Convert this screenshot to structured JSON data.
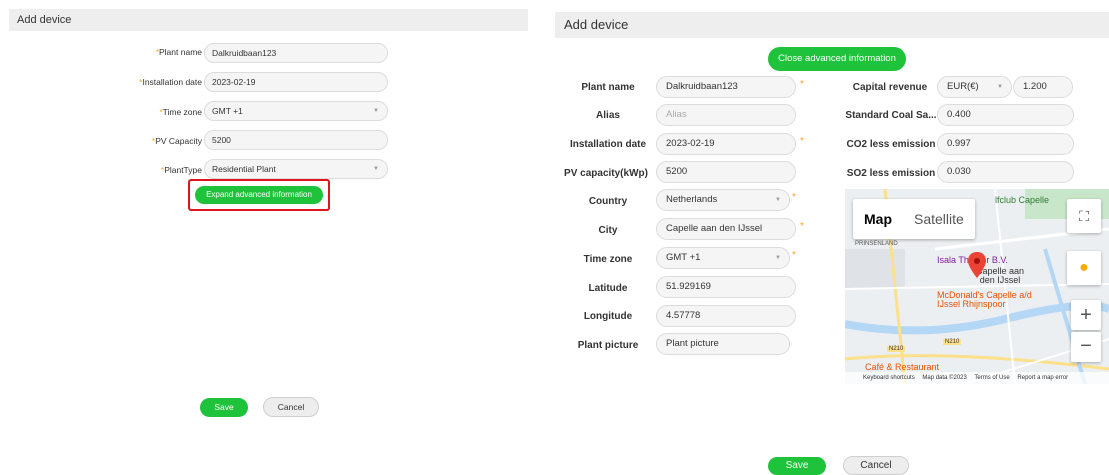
{
  "left": {
    "title": "Add device",
    "fields": {
      "plant_name": {
        "label": "Plant name",
        "value": "Dalkruidbaan123"
      },
      "installation_date": {
        "label": "Installation date",
        "value": "2023-02-19"
      },
      "time_zone": {
        "label": "Time zone",
        "value": "GMT +1"
      },
      "pv_capacity": {
        "label": "PV Capacity",
        "value": "5200"
      },
      "plant_type": {
        "label": "PlantType",
        "value": "Residential Plant"
      }
    },
    "expand_button": "Expand advanced information",
    "save": "Save",
    "cancel": "Cancel"
  },
  "right": {
    "title": "Add device",
    "close_button": "Close advanced information",
    "fields": {
      "plant_name": {
        "label": "Plant name",
        "value": "Dalkruidbaan123"
      },
      "alias": {
        "label": "Alias",
        "placeholder": "Alias"
      },
      "installation_date": {
        "label": "Installation date",
        "value": "2023-02-19"
      },
      "pv_capacity": {
        "label": "PV capacity(kWp)",
        "value": "5200"
      },
      "country": {
        "label": "Country",
        "value": "Netherlands"
      },
      "city": {
        "label": "City",
        "value": "Capelle aan den IJssel"
      },
      "time_zone": {
        "label": "Time zone",
        "value": "GMT +1"
      },
      "latitude": {
        "label": "Latitude",
        "value": "51.929169"
      },
      "longitude": {
        "label": "Longitude",
        "value": "4.57778"
      },
      "plant_picture": {
        "label": "Plant picture",
        "placeholder": "Plant picture"
      },
      "capital_revenue": {
        "label": "Capital revenue",
        "currency": "EUR(€)",
        "value": "1.200"
      },
      "standard_coal": {
        "label": "Standard Coal Sa...",
        "value": "0.400"
      },
      "co2": {
        "label": "CO2 less emission",
        "value": "0.997"
      },
      "so2": {
        "label": "SO2 less emission",
        "value": "0.030"
      }
    },
    "map": {
      "tab_map": "Map",
      "tab_satellite": "Satellite",
      "places": {
        "golfclub": "lfclub Capelle",
        "prinsenland": "PRINSENLAND",
        "isala": "Isala Theater B.V.",
        "capelle": "Capelle aan den IJssel",
        "mcdonalds": "McDonald's Capelle a/d IJssel Rhijnspoor",
        "cafe": "Café & Restaurant",
        "n210a": "N210",
        "n210b": "N210"
      },
      "footer": {
        "shortcuts": "Keyboard shortcuts",
        "mapdata": "Map data ©2023",
        "terms": "Terms of Use",
        "report": "Report a map error"
      }
    },
    "save": "Save",
    "cancel": "Cancel"
  },
  "colors": {
    "accent": "#1fc23b",
    "highlight": "#e0141e",
    "required": "#f5a623"
  }
}
